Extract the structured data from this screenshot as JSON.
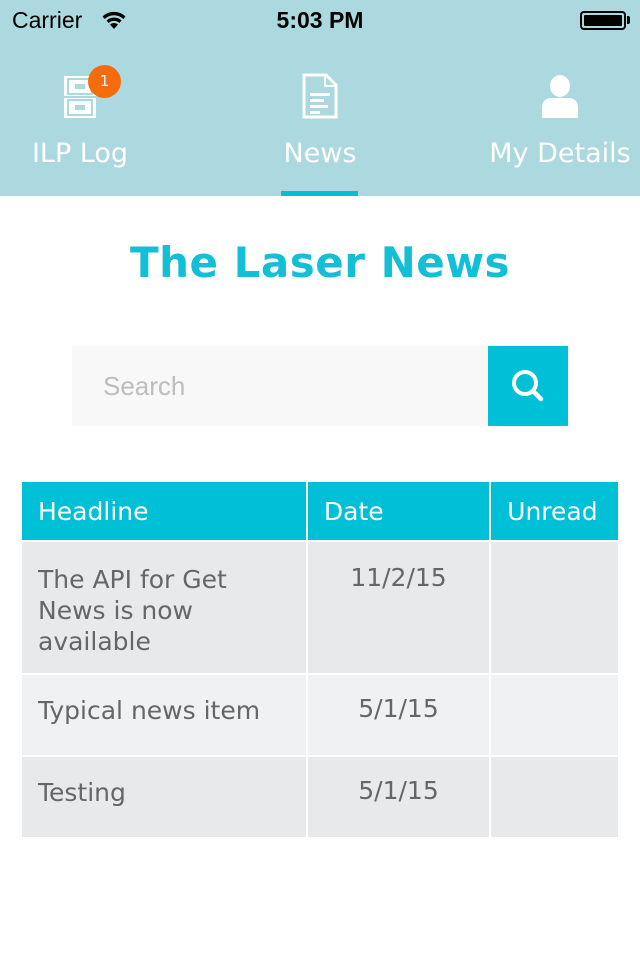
{
  "status_bar": {
    "carrier": "Carrier",
    "time": "5:03 PM",
    "wifi_icon": "wifi-icon",
    "battery_icon": "battery-icon",
    "battery_level": 1.0
  },
  "tabs": [
    {
      "label": "ILP Log",
      "icon": "file-cabinet-icon",
      "badge": "1",
      "active": false
    },
    {
      "label": "News",
      "icon": "document-icon",
      "active": true
    },
    {
      "label": "My Details",
      "icon": "person-icon",
      "active": false
    }
  ],
  "page": {
    "title": "The Laser News"
  },
  "search": {
    "placeholder": "Search",
    "value": "",
    "button_icon": "search-icon"
  },
  "table": {
    "columns": [
      "Headline",
      "Date",
      "Unread"
    ],
    "rows": [
      {
        "headline": "The API for Get News is now available",
        "date": "11/2/15",
        "unread": ""
      },
      {
        "headline": "Typical news item",
        "date": "5/1/15",
        "unread": ""
      },
      {
        "headline": "Testing",
        "date": "5/1/15",
        "unread": ""
      }
    ]
  },
  "colors": {
    "header_bg": "#abd9df",
    "accent": "#00c0d8",
    "title": "#12bfd6",
    "badge": "#f56c0d",
    "row_odd": "#e8e9eb",
    "row_even": "#f0f1f3"
  }
}
